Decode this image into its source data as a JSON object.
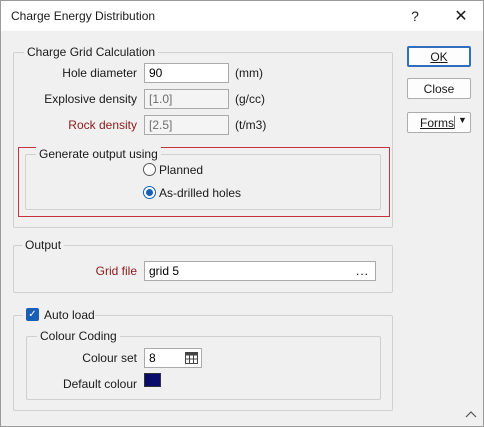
{
  "window": {
    "title": "Charge Energy Distribution",
    "help_glyph": "?",
    "close_glyph": "✕"
  },
  "buttons": {
    "ok": "OK",
    "close": "Close",
    "forms": "Forms",
    "forms_arrow": "▼"
  },
  "charge_grid": {
    "title": "Charge Grid Calculation",
    "hole_diameter": {
      "label": "Hole diameter",
      "value": "90",
      "unit": "(mm)"
    },
    "explosive_density": {
      "label": "Explosive density",
      "value": "[1.0]",
      "unit": "(g/cc)"
    },
    "rock_density": {
      "label": "Rock density",
      "value": "[2.5]",
      "unit": "(t/m3)"
    }
  },
  "generate_output": {
    "title": "Generate output using",
    "options": [
      {
        "label": "Planned",
        "selected": false
      },
      {
        "label": "As-drilled holes",
        "selected": true
      }
    ]
  },
  "output": {
    "title": "Output",
    "grid_file_label": "Grid file",
    "grid_file_value": "grid 5",
    "browse_label": "..."
  },
  "auto_load": {
    "label": "Auto load",
    "checked": true,
    "check_glyph": "✓"
  },
  "colour_coding": {
    "title": "Colour Coding",
    "colour_set_label": "Colour set",
    "colour_set_value": "8",
    "default_colour_label": "Default colour",
    "default_colour": "#0b0b6b"
  },
  "colors": {
    "accent": "#1a5fb4",
    "label_red": "#8b1a1a",
    "highlight_border": "#c8323c"
  },
  "icons": {
    "colour_set_picker": "table-icon",
    "resize": "resize-grip-icon",
    "collapse": "chevron-up-icon"
  }
}
